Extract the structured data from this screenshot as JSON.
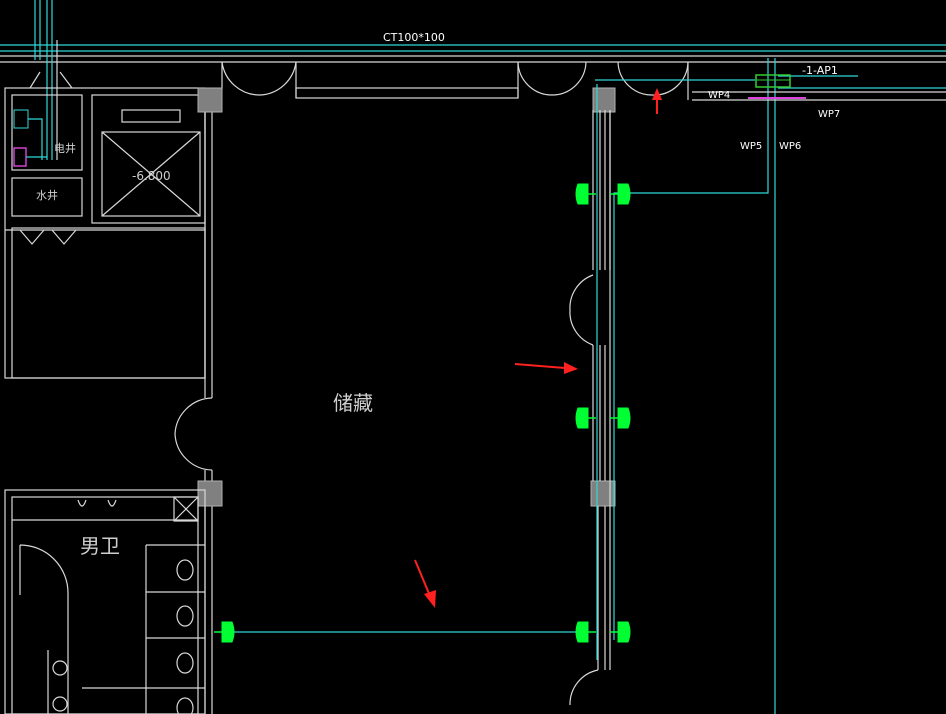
{
  "drawing": {
    "tray_label": "CT100*100",
    "panel_label": "-1-AP1",
    "circuits": [
      "WP4",
      "WP5",
      "WP6",
      "WP7"
    ],
    "rooms": {
      "storage": "储藏",
      "mens_toilet": "男卫",
      "elec_shaft": "电井",
      "water_shaft": "水井",
      "elevator_level": "-6.800"
    },
    "colors": {
      "background": "#000000",
      "wall": "#d8d8d8",
      "cable": "#2fd8d8",
      "fixture": "#00ff33",
      "panel": "#33cc33",
      "magenta": "#dd44dd",
      "arrow": "#ff2020",
      "column": "#808080"
    },
    "annotation_arrows": 3
  }
}
